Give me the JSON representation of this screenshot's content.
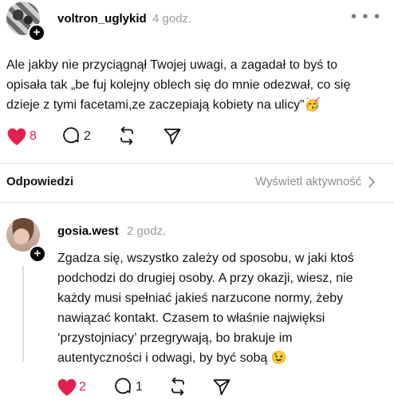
{
  "post": {
    "username": "voltron_uglykid",
    "time": "4 godz.",
    "text_lines": [
      "Ale jakby nie przyciągnął Twojej uwagi, a zagadał to byś to",
      "opisała tak „be fuj kolejny oblech się do mnie odezwał, co się",
      "dzieje z tymi facetami,ze zaczepiają kobiety na ulicy”🥳"
    ],
    "likes": "8",
    "replies": "2",
    "more": "• • •"
  },
  "replies_header": {
    "title": "Odpowiedzi",
    "activity_link": "Wyświetl aktywność"
  },
  "reply": {
    "username": "gosia.west",
    "time": "2 godz.",
    "text_lines": [
      "Zgadza się, wszystko zależy od sposobu, w jaki ktoś",
      "podchodzi do drugiej osoby. A przy okazji, wiesz, nie",
      "każdy musi spełniać jakieś narzucone normy, żeby",
      "nawiązać kontakt. Czasem to właśnie najwięksi",
      "‘przystojniacy’ przegrywają, bo brakuje im",
      "autentyczności i odwagi, by być sobą 😉"
    ],
    "likes": "2",
    "replies": "1"
  },
  "colors": {
    "like": "#e0214f",
    "muted": "#9a9a9a",
    "divider": "#e3e3e3"
  },
  "icons": [
    "heart-icon",
    "comment-icon",
    "repost-icon",
    "share-icon",
    "plus-icon",
    "chevron-right-icon",
    "more-icon"
  ]
}
